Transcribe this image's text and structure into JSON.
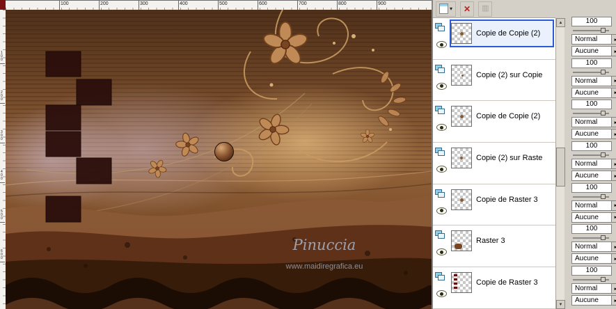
{
  "colors": {
    "selection_blue": "#2a5bd7",
    "panel_gray": "#d4d0c8",
    "delete_red": "#c02020"
  },
  "rulers": {
    "horizontal_labels": [
      "100",
      "200",
      "300",
      "400",
      "500",
      "600",
      "700",
      "800",
      "900"
    ],
    "vertical_labels": [
      "100",
      "200",
      "300",
      "400",
      "500",
      "600"
    ]
  },
  "canvas": {
    "signature": "Pinuccia",
    "watermark": "www.maidiregrafica.eu"
  },
  "icons": {
    "dropdown_arrow": "▾",
    "delete": "✕",
    "panel": "▥",
    "combo_arrow": "▸",
    "scroll_up": "▲",
    "scroll_down": "▼"
  },
  "layers": [
    {
      "name": "Copie de Copie (2)",
      "selected": true
    },
    {
      "name": "Copie (2) sur Copie",
      "selected": false
    },
    {
      "name": "Copie de Copie (2)",
      "selected": false
    },
    {
      "name": "Copie (2) sur Raste",
      "selected": false
    },
    {
      "name": "Copie de Raster 3",
      "selected": false
    },
    {
      "name": "Raster 3",
      "selected": false
    },
    {
      "name": "Copie de Raster 3",
      "selected": false
    }
  ],
  "properties": {
    "rows": [
      {
        "opacity": "100",
        "blend": "Normal",
        "link": "Aucune"
      },
      {
        "opacity": "100",
        "blend": "Normal",
        "link": "Aucune"
      },
      {
        "opacity": "100",
        "blend": "Normal",
        "link": "Aucune"
      },
      {
        "opacity": "100",
        "blend": "Normal",
        "link": "Aucune"
      },
      {
        "opacity": "100",
        "blend": "Normal",
        "link": "Aucune"
      },
      {
        "opacity": "100",
        "blend": "Normal",
        "link": "Aucune"
      },
      {
        "opacity": "100",
        "blend": "Normal",
        "link": "Aucune"
      }
    ]
  }
}
